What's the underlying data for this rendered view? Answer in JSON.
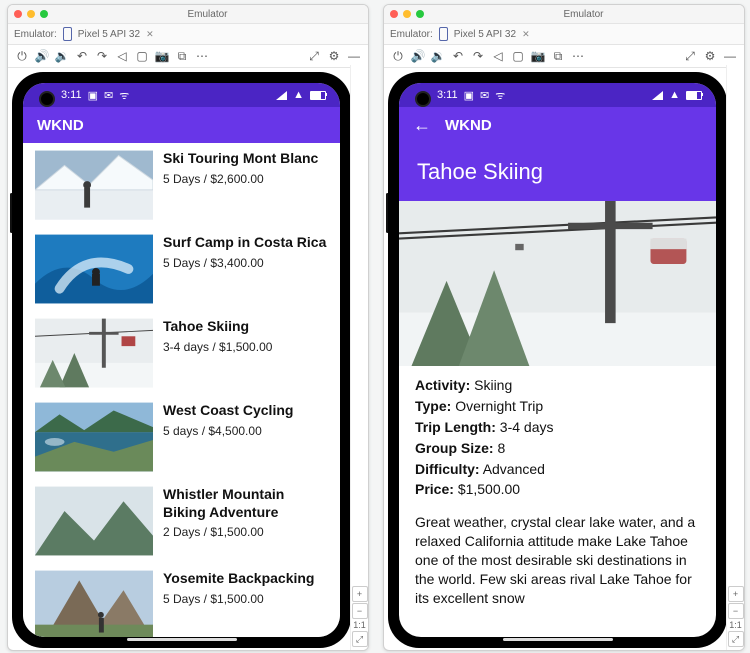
{
  "emulator": {
    "window_title": "Emulator",
    "emulator_label": "Emulator:",
    "device_tab": "Pixel 5 API 32",
    "zoom_ratio": "1:1"
  },
  "status_bar": {
    "time": "3:11"
  },
  "app": {
    "title": "WKND"
  },
  "adventures": [
    {
      "title": "Ski Touring Mont Blanc",
      "subtitle": "5 Days / $2,600.00"
    },
    {
      "title": "Surf Camp in Costa Rica",
      "subtitle": "5 Days / $3,400.00"
    },
    {
      "title": "Tahoe Skiing",
      "subtitle": "3-4 days / $1,500.00"
    },
    {
      "title": "West Coast Cycling",
      "subtitle": "5 days / $4,500.00"
    },
    {
      "title": "Whistler Mountain Biking Adventure",
      "subtitle": "2 Days / $1,500.00"
    },
    {
      "title": "Yosemite Backpacking",
      "subtitle": "5 Days / $1,500.00"
    }
  ],
  "detail": {
    "title": "Tahoe Skiing",
    "labels": {
      "activity": "Activity:",
      "type": "Type:",
      "trip_length": "Trip Length:",
      "group_size": "Group Size:",
      "difficulty": "Difficulty:",
      "price": "Price:"
    },
    "values": {
      "activity": "Skiing",
      "type": "Overnight Trip",
      "trip_length": "3-4 days",
      "group_size": "8",
      "difficulty": "Advanced",
      "price": "$1,500.00"
    },
    "description": "Great weather, crystal clear lake water, and a relaxed California attitude make Lake Tahoe one of the most desirable ski destinations in the world. Few ski areas rival Lake Tahoe for its excellent snow"
  }
}
